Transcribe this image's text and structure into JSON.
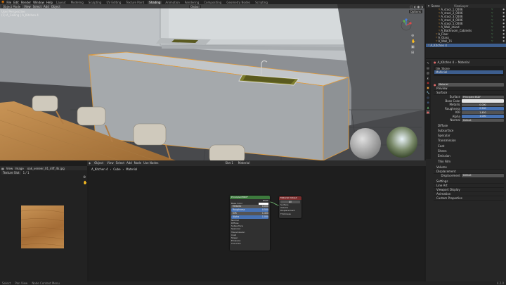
{
  "menu": [
    "File",
    "Edit",
    "Render",
    "Window",
    "Help"
  ],
  "workspaces": [
    "Layout",
    "Modeling",
    "Sculpting",
    "UV Editing",
    "Texture Paint",
    "Shading",
    "Animation",
    "Rendering",
    "Compositing",
    "Geometry Nodes",
    "Scripting"
  ],
  "active_workspace": "Shading",
  "viewport": {
    "mode": "Object Mode",
    "menus": [
      "View",
      "Select",
      "Add",
      "Object"
    ],
    "shading": "Global",
    "info1": "User Perspective",
    "info2": "(1) A_Ceiling | A_Kitchen 4",
    "options": "Options"
  },
  "outliner": {
    "scene": "Scene",
    "view_layer": "ViewLayer",
    "items": [
      "A_stool_1_0006",
      "A_stool_2_0006",
      "A_stool_3_0006",
      "A_stool_4_0006",
      "A_stool_5_0006",
      "A_Wall_stand",
      "A_Bathroom_Cabinets",
      "A_Floor",
      "A_Glass",
      "A_Wall_Tri"
    ]
  },
  "properties": {
    "object": "A_Kitchen 4",
    "tab": "Material",
    "slots": [
      "tile_Stone",
      "Material"
    ],
    "material": "Material",
    "surface_label": "Surface",
    "preview": "Preview",
    "surface_section": "Surface",
    "shader": "Principled BSDF",
    "rows": [
      {
        "label": "Base Color",
        "value": ""
      },
      {
        "label": "Metallic",
        "value": "0.000"
      },
      {
        "label": "Roughness",
        "value": "0.500"
      },
      {
        "label": "IOR",
        "value": "1.450"
      },
      {
        "label": "Alpha",
        "value": "1.000"
      },
      {
        "label": "Normal",
        "value": "Default"
      }
    ],
    "subsections": [
      "Diffuse",
      "Subsurface",
      "Specular",
      "Transmission",
      "Coat",
      "Sheen",
      "Emission",
      "Thin Film"
    ],
    "volume": "Volume",
    "displacement": "Displacement",
    "disp_label": "Displacement",
    "disp_value": "Default",
    "bottom": [
      "Settings",
      "Line Art",
      "Viewport Display",
      "Animation",
      "Custom Properties"
    ]
  },
  "image_editor": {
    "menus": [
      "View",
      "Image"
    ],
    "image": "oak_veneer_01_diff_4k.jpg",
    "slot": "Texture Slot",
    "frame": "1 / 1"
  },
  "node_editor": {
    "object": "A_Kitchen 4",
    "slot": "Slot 1",
    "material": "Material",
    "use_nodes": "Use Nodes",
    "menus": [
      "Object",
      "View",
      "Select",
      "Add",
      "Node"
    ],
    "breadcrumb": [
      "A_Kitchen 4",
      "Cube",
      "Material"
    ],
    "bsdf": {
      "title": "Principled BSDF",
      "out": "BSDF",
      "rows": [
        "Base Color",
        "Metallic",
        "Roughness",
        "IOR",
        "Alpha",
        "Normal"
      ],
      "vals": [
        "",
        "0.000",
        "0.500",
        "1.450",
        "1.000",
        ""
      ],
      "subs": [
        "Diffuse",
        "Subsurface",
        "Specular",
        "Transmission",
        "Coat",
        "Sheen",
        "Emission",
        "Thin Film"
      ]
    },
    "output": {
      "title": "Material Output",
      "target": "All",
      "sockets": [
        "Surface",
        "Volume",
        "Displacement",
        "Thickness"
      ]
    }
  },
  "status": [
    "Select",
    "Pan View",
    "Node Context Menu",
    "4.2.0"
  ]
}
